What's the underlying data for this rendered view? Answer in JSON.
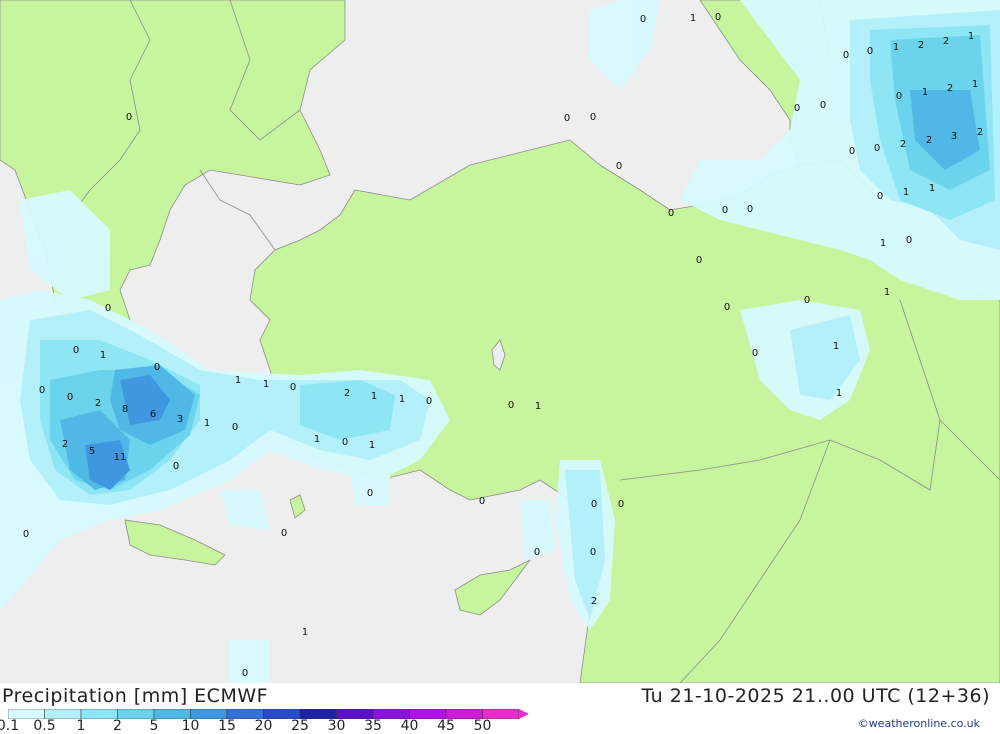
{
  "footer": {
    "title_left": "Precipitation [mm] ECMWF",
    "title_right": "Tu 21-10-2025 21..00 UTC (12+36)",
    "credit": "©weatheronline.co.uk"
  },
  "legend": {
    "ticks": [
      "0.1",
      "0.5",
      "1",
      "2",
      "5",
      "10",
      "15",
      "20",
      "25",
      "30",
      "35",
      "40",
      "45",
      "50"
    ],
    "colors": [
      "#d6fafe",
      "#b4f0fa",
      "#8ee5f3",
      "#6bd4ec",
      "#4fb8e6",
      "#3f97e0",
      "#3572d6",
      "#2a4bc9",
      "#1d22a8",
      "#5a0fc8",
      "#8a12dc",
      "#b012e6",
      "#d01ad6",
      "#e82ccc"
    ]
  },
  "colors": {
    "sea": "#eeeeee",
    "land": "#c6f59d",
    "border": "#8c8c8c",
    "coast": "#8c8c8c"
  },
  "map": {
    "values": [
      "0",
      "1",
      "0",
      "0",
      "1",
      "2",
      "2",
      "1",
      "0",
      "0",
      "1",
      "2",
      "1",
      "0",
      "0",
      "0",
      "0",
      "2",
      "2",
      "3",
      "2",
      "0",
      "0",
      "0",
      "1",
      "1",
      "0",
      "0",
      "1",
      "0",
      "0",
      "0",
      "0",
      "0",
      "1",
      "0",
      "0",
      "0",
      "1",
      "0",
      "0",
      "1",
      "0",
      "0",
      "2",
      "8",
      "6",
      "3",
      "2",
      "5",
      "11",
      "1",
      "1",
      "0",
      "0",
      "1",
      "1",
      "0",
      "2",
      "1",
      "1",
      "0",
      "1",
      "0",
      "1",
      "0",
      "1",
      "0",
      "0",
      "0",
      "0",
      "0",
      "0",
      "0",
      "0",
      "2",
      "1",
      "0",
      "0"
    ]
  }
}
